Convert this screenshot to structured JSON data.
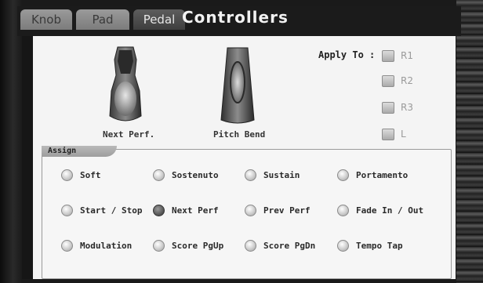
{
  "header": {
    "tabs": [
      {
        "label": "Knob",
        "active": false
      },
      {
        "label": "Pad",
        "active": false
      },
      {
        "label": "Pedal",
        "active": true
      }
    ],
    "title": "Controllers"
  },
  "pedals": {
    "left_label": "Next Perf.",
    "right_label": "Pitch Bend"
  },
  "apply_to": {
    "label": "Apply To :",
    "options": [
      {
        "label": "R1",
        "checked": false
      },
      {
        "label": "R2",
        "checked": false
      },
      {
        "label": "R3",
        "checked": false
      },
      {
        "label": "L",
        "checked": false
      }
    ]
  },
  "assign": {
    "title": "Assign",
    "selected": "Next Perf",
    "options": [
      {
        "label": "Soft"
      },
      {
        "label": "Sostenuto"
      },
      {
        "label": "Sustain"
      },
      {
        "label": "Portamento"
      },
      {
        "label": "Start / Stop"
      },
      {
        "label": "Next Perf"
      },
      {
        "label": "Prev Perf"
      },
      {
        "label": "Fade In / Out"
      },
      {
        "label": "Modulation"
      },
      {
        "label": "Score PgUp"
      },
      {
        "label": "Score PgDn"
      },
      {
        "label": "Tempo Tap"
      }
    ]
  }
}
